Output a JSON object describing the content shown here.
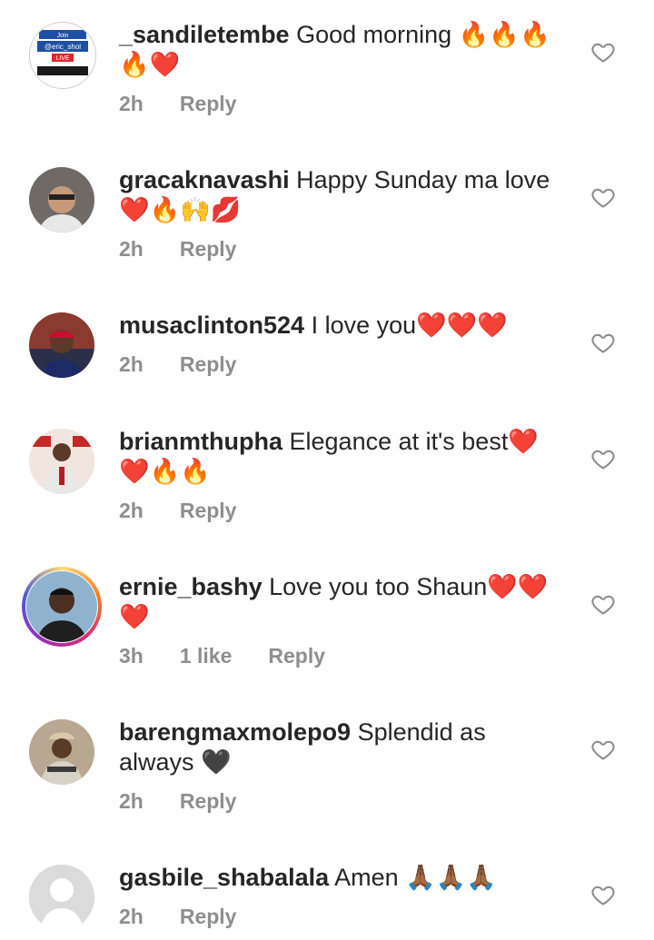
{
  "comments": [
    {
      "username": "_sandiletembe",
      "text": "Good morning",
      "emoji_line1": "🔥🔥🔥",
      "emoji_line2": "🔥❤️",
      "time": "2h",
      "likes": "",
      "reply": "Reply",
      "avatar_caption": "@eric_shol",
      "avatar_badge": "LIVE",
      "avatar_top": "Join"
    },
    {
      "username": "gracaknavashi",
      "text": "Happy Sunday ma love",
      "emoji_line2": "❤️🔥🙌💋",
      "time": "2h",
      "likes": "",
      "reply": "Reply"
    },
    {
      "username": "musaclinton524",
      "text": "I love you❤️❤️❤️",
      "time": "2h",
      "likes": "",
      "reply": "Reply"
    },
    {
      "username": "brianmthupha",
      "text": "Elegance at it's best❤️",
      "emoji_line2": "❤️🔥🔥",
      "time": "2h",
      "likes": "",
      "reply": "Reply"
    },
    {
      "username": "ernie_bashy",
      "text": "Love you too Shaun❤️❤️",
      "emoji_line2": "❤️",
      "time": "3h",
      "likes": "1 like",
      "reply": "Reply"
    },
    {
      "username": "barengmaxmolepo9",
      "text": "Splendid as",
      "text_line2": "always 🖤",
      "time": "2h",
      "likes": "",
      "reply": "Reply"
    },
    {
      "username": "gasbile_shabalala",
      "text": "Amen 🙏🏾🙏🏾🙏🏾",
      "time": "2h",
      "likes": "",
      "reply": "Reply"
    }
  ],
  "icons": {
    "like": "heart-outline-icon",
    "avatar_default": "default-user-icon"
  },
  "colors": {
    "meta": "#8e8e8e",
    "text": "#262626",
    "icon": "#8e8e8e"
  }
}
